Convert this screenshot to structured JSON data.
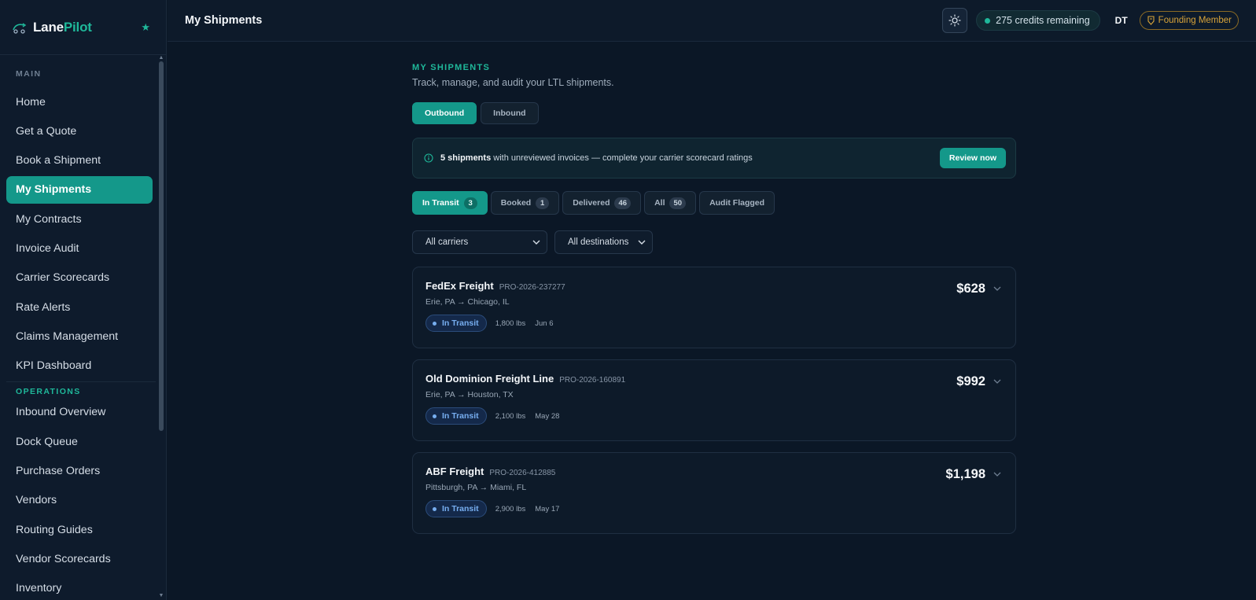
{
  "brand": {
    "name_part1": "Lane",
    "name_part2": "Pilot"
  },
  "sidebar": {
    "main_label": "MAIN",
    "main_items": [
      {
        "label": "Home"
      },
      {
        "label": "Get a Quote"
      },
      {
        "label": "Book a Shipment"
      },
      {
        "label": "My Shipments"
      },
      {
        "label": "My Contracts"
      },
      {
        "label": "Invoice Audit"
      },
      {
        "label": "Carrier Scorecards"
      },
      {
        "label": "Rate Alerts"
      },
      {
        "label": "Claims Management"
      },
      {
        "label": "KPI Dashboard"
      }
    ],
    "ops_label": "OPERATIONS",
    "ops_items": [
      {
        "label": "Inbound Overview"
      },
      {
        "label": "Dock Queue"
      },
      {
        "label": "Purchase Orders"
      },
      {
        "label": "Vendors"
      },
      {
        "label": "Routing Guides"
      },
      {
        "label": "Vendor Scorecards"
      },
      {
        "label": "Inventory"
      }
    ]
  },
  "topbar": {
    "title": "My Shipments",
    "credits": "275 credits remaining",
    "avatar_initials": "DT",
    "badge": "Founding Member"
  },
  "page": {
    "eyebrow": "MY SHIPMENTS",
    "subtitle": "Track, manage, and audit your LTL shipments.",
    "direction_tabs": [
      {
        "label": "Outbound"
      },
      {
        "label": "Inbound"
      }
    ],
    "notice": {
      "bold": "5 shipments",
      "text": " with unreviewed invoices — complete your carrier scorecard ratings",
      "button": "Review now"
    },
    "status_tabs": [
      {
        "label": "In Transit",
        "count": "3"
      },
      {
        "label": "Booked",
        "count": "1"
      },
      {
        "label": "Delivered",
        "count": "46"
      },
      {
        "label": "All",
        "count": "50"
      },
      {
        "label": "Audit Flagged"
      }
    ],
    "filters": {
      "carriers": "All carriers",
      "destinations": "All destinations"
    },
    "shipments": [
      {
        "carrier": "FedEx Freight",
        "pro": "PRO-2026-237277",
        "route": "Erie, PA → Chicago, IL",
        "status": "In Transit",
        "weight": "1,800 lbs",
        "date": "Jun 6",
        "price": "$628"
      },
      {
        "carrier": "Old Dominion Freight Line",
        "pro": "PRO-2026-160891",
        "route": "Erie, PA → Houston, TX",
        "status": "In Transit",
        "weight": "2,100 lbs",
        "date": "May 28",
        "price": "$992"
      },
      {
        "carrier": "ABF Freight",
        "pro": "PRO-2026-412885",
        "route": "Pittsburgh, PA → Miami, FL",
        "status": "In Transit",
        "weight": "2,900 lbs",
        "date": "May 17",
        "price": "$1,198"
      }
    ]
  },
  "colors": {
    "accent": "#14988a",
    "brand_green": "#1fb89a",
    "status_blue": "#77aef0",
    "gold": "#d9a43a",
    "background": "#0b1726"
  },
  "icons": {
    "logo": "truck-logo-icon",
    "favorite": "star-icon",
    "theme": "sun-icon",
    "info": "info-icon",
    "badge": "medal-icon",
    "dropdown": "chevron-down-icon"
  }
}
